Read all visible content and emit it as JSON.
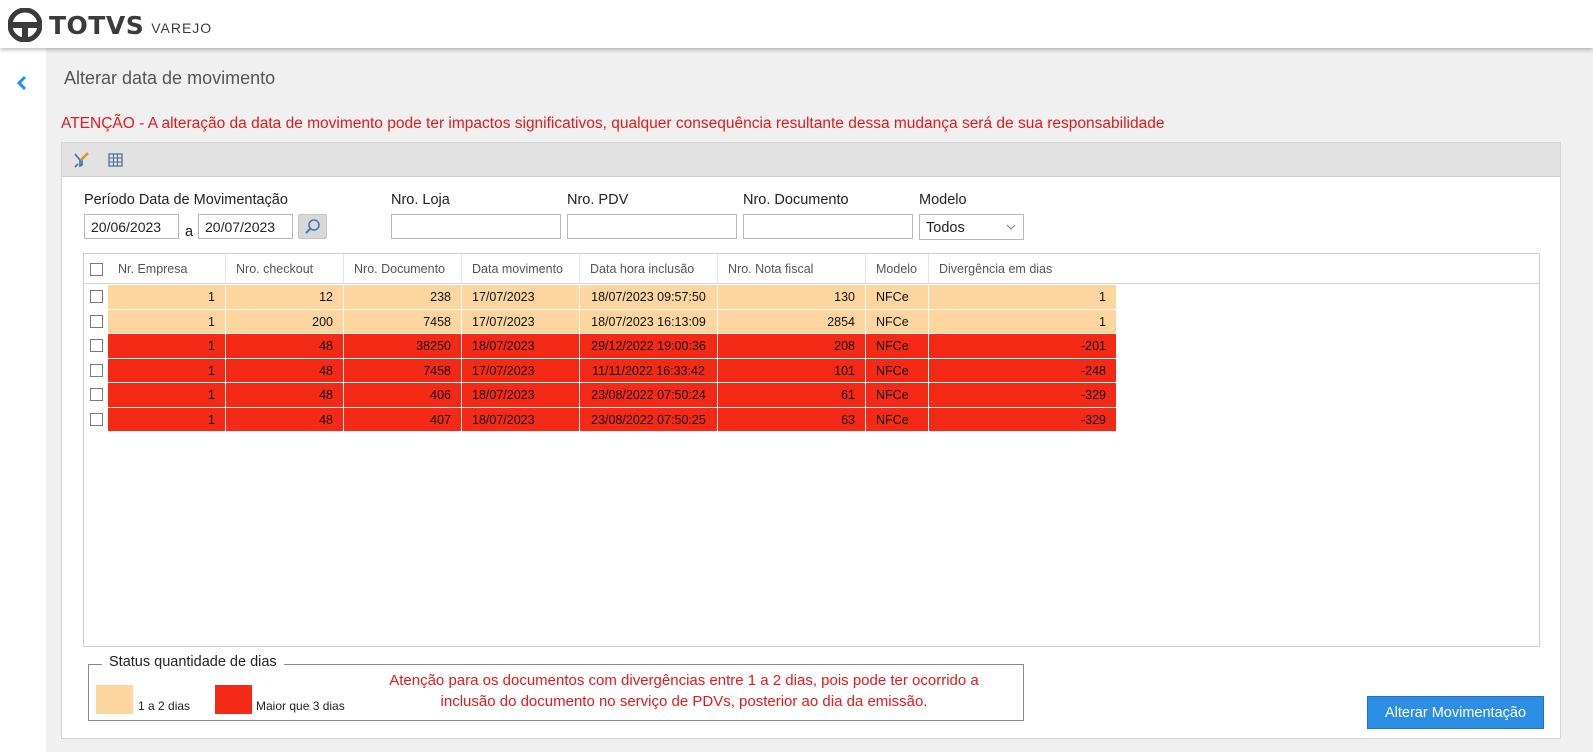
{
  "header": {
    "brand": "TOTVS",
    "product": "VAREJO"
  },
  "page": {
    "title": "Alterar data de movimento",
    "warning": "ATENÇÃO - A alteração da data de movimento pode ter impactos significativos, qualquer consequência resultante dessa mudança será de sua responsabilidade"
  },
  "toolbar": {
    "icons": [
      "clear-filter-icon",
      "grid-icon"
    ]
  },
  "filters": {
    "period_label": "Período Data de Movimentação",
    "date_from": "20/06/2023",
    "date_sep": "a",
    "date_to": "20/07/2023",
    "store_label": "Nro. Loja",
    "store_value": "",
    "pdv_label": "Nro. PDV",
    "pdv_value": "",
    "doc_label": "Nro. Documento",
    "doc_value": "",
    "model_label": "Modelo",
    "model_value": "Todos"
  },
  "grid": {
    "columns": [
      "Nr. Empresa",
      "Nro. checkout",
      "Nro. Documento",
      "Data movimento",
      "Data hora inclusão",
      "Nro. Nota fiscal",
      "Modelo",
      "Divergência em dias"
    ],
    "rows": [
      {
        "status": "1 a 2 dias",
        "cells": [
          "1",
          "12",
          "238",
          "17/07/2023",
          "18/07/2023 09:57:50",
          "130",
          "NFCe",
          "1"
        ]
      },
      {
        "status": "1 a 2 dias",
        "cells": [
          "1",
          "200",
          "7458",
          "17/07/2023",
          "18/07/2023 16:13:09",
          "2854",
          "NFCe",
          "1"
        ]
      },
      {
        "status": "Maior que 3 dias",
        "cells": [
          "1",
          "48",
          "38250",
          "18/07/2023",
          "29/12/2022 19:00:36",
          "208",
          "NFCe",
          "-201"
        ]
      },
      {
        "status": "Maior que 3 dias",
        "cells": [
          "1",
          "48",
          "7458",
          "17/07/2023",
          "11/11/2022 16:33:42",
          "101",
          "NFCe",
          "-248"
        ]
      },
      {
        "status": "Maior que 3 dias",
        "cells": [
          "1",
          "48",
          "406",
          "18/07/2023",
          "23/08/2022 07:50:24",
          "61",
          "NFCe",
          "-329"
        ]
      },
      {
        "status": "Maior que 3 dias",
        "cells": [
          "1",
          "48",
          "407",
          "18/07/2023",
          "23/08/2022 07:50:25",
          "63",
          "NFCe",
          "-329"
        ]
      }
    ]
  },
  "legend": {
    "title": "Status quantidade de dias",
    "items": [
      {
        "label": "1 a 2 dias",
        "color": "#fdd59e"
      },
      {
        "label": "Maior que 3 dias",
        "color": "#f52a16"
      }
    ],
    "note": "Atenção para os documentos com divergências entre 1 a 2 dias, pois pode ter ocorrido a inclusão do documento no serviço de PDVs, posterior ao dia da emissão."
  },
  "actions": {
    "primary": "Alterar Movimentação"
  },
  "colors": {
    "accent": "#2d8ee6",
    "warning_text": "#e21a1a",
    "row_low": "#fdd59e",
    "row_high": "#f52a16"
  }
}
